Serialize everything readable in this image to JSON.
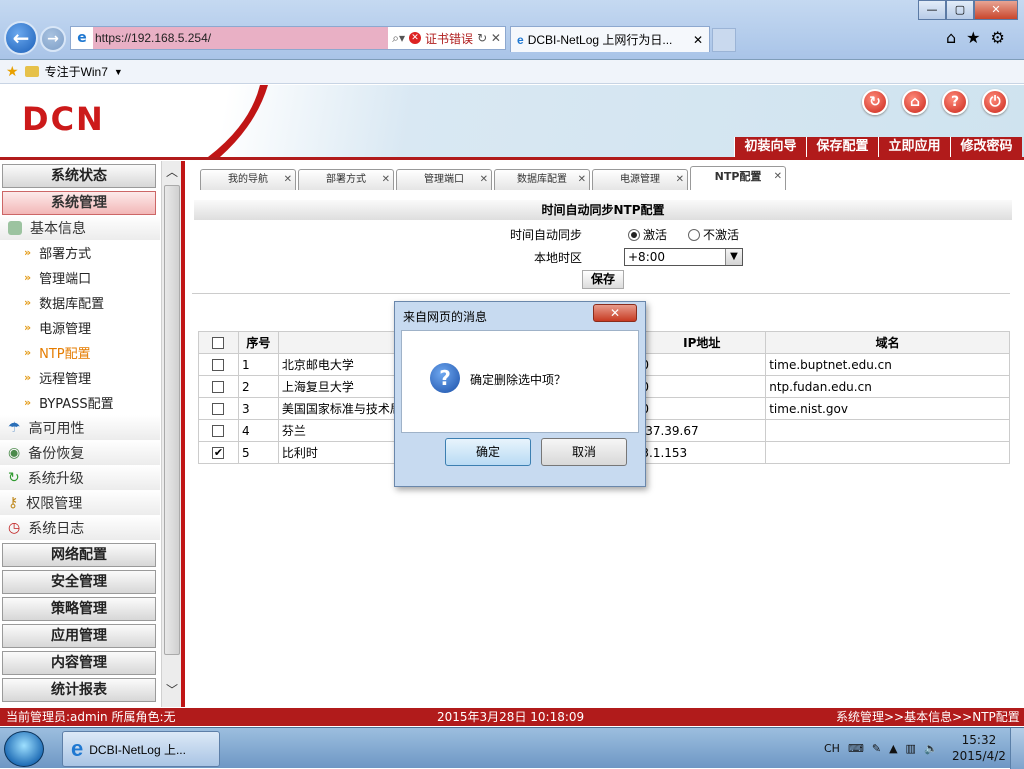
{
  "browser": {
    "url": "https://192.168.5.254/",
    "cert_error": "证书错误",
    "tab_title": "DCBI-NetLog 上网行为日...",
    "window_buttons": [
      "—",
      "▢",
      "✕"
    ],
    "fav_label": "专注于Win7"
  },
  "header": {
    "logo": "DCN",
    "menu": [
      "初装向导",
      "保存配置",
      "立即应用",
      "修改密码"
    ]
  },
  "sidebar": {
    "sections_top": [
      {
        "label": "系统状态",
        "active": false
      },
      {
        "label": "系统管理",
        "active": true
      }
    ],
    "group_basic": "基本信息",
    "items": [
      "部署方式",
      "管理端口",
      "数据库配置",
      "电源管理",
      "NTP配置",
      "远程管理",
      "BYPASS配置"
    ],
    "active_item": "NTP配置",
    "groups": [
      "高可用性",
      "备份恢复",
      "系统升级",
      "权限管理",
      "系统日志"
    ],
    "sections_bottom": [
      "网络配置",
      "安全管理",
      "策略管理",
      "应用管理",
      "内容管理",
      "统计报表"
    ]
  },
  "content_tabs": [
    "我的导航",
    "部署方式",
    "管理端口",
    "数据库配置",
    "电源管理",
    "NTP配置"
  ],
  "ntp": {
    "section_title": "时间自动同步NTP配置",
    "sync_label": "时间自动同步",
    "opt_on": "激活",
    "opt_off": "不激活",
    "tz_label": "本地时区",
    "tz_value": "+8:00",
    "save": "保存"
  },
  "table": {
    "headers": [
      "",
      "序号",
      "",
      "IP地址",
      "域名"
    ],
    "rows": [
      {
        "checked": false,
        "no": "1",
        "name": "北京邮电大学",
        "ip": "0",
        "domain": "time.buptnet.edu.cn"
      },
      {
        "checked": false,
        "no": "2",
        "name": "上海复旦大学",
        "ip": "0",
        "domain": "ntp.fudan.edu.cn"
      },
      {
        "checked": false,
        "no": "3",
        "name": "美国国家标准与技术局",
        "ip": "0",
        "domain": "time.nist.gov"
      },
      {
        "checked": false,
        "no": "4",
        "name": "芬兰",
        "ip": ".37.39.67",
        "domain": ""
      },
      {
        "checked": true,
        "no": "5",
        "name": "比利时",
        "ip": "3.1.153",
        "domain": ""
      }
    ]
  },
  "dialog": {
    "title": "来自网页的消息",
    "message": "确定删除选中项？",
    "ok": "确定",
    "cancel": "取消"
  },
  "status": {
    "user": "当前管理员:admin  所属角色:无",
    "datetime": "2015年3月28日  10:18:09",
    "path": "系统管理>>基本信息>>NTP配置"
  },
  "taskbar": {
    "item": "DCBI-NetLog 上...",
    "lang": "CH",
    "time": "15:32",
    "date": "2015/4/2"
  }
}
